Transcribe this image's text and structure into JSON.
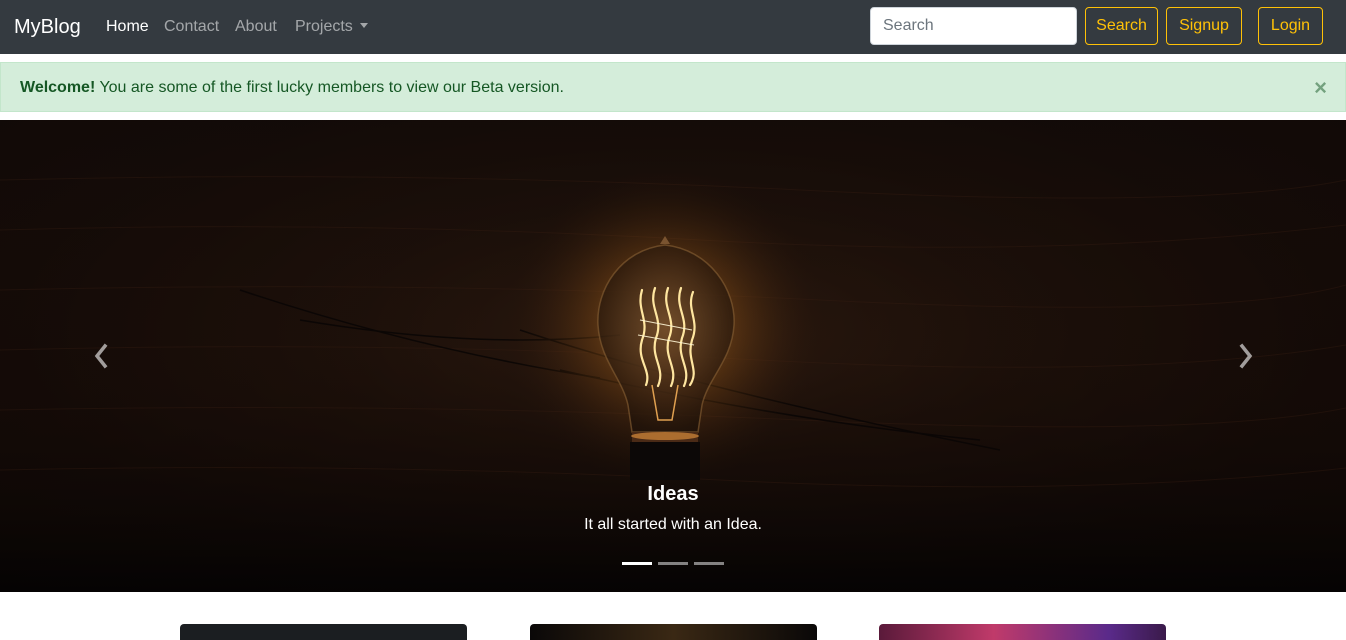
{
  "navbar": {
    "brand": "MyBlog",
    "links": [
      {
        "label": "Home",
        "active": true
      },
      {
        "label": "Contact",
        "active": false
      },
      {
        "label": "About",
        "active": false
      },
      {
        "label": "Projects",
        "active": false,
        "dropdown": true
      }
    ],
    "search": {
      "placeholder": "Search",
      "value": ""
    },
    "search_button": "Search",
    "signup_button": "Signup",
    "login_button": "Login",
    "accent_color": "#ffc107",
    "background_color": "#343a40"
  },
  "alert": {
    "strong": "Welcome!",
    "text": " You are some of the first lucky members to view our Beta version.",
    "close": "×",
    "background_color": "#d4edda"
  },
  "carousel": {
    "caption_title": "Ideas",
    "caption_text": "It all started with an Idea.",
    "slide_count": 3,
    "active_slide": 1,
    "prev_icon": "chevron-left-icon",
    "next_icon": "chevron-right-icon"
  },
  "cards": {
    "count_visible": 3
  }
}
